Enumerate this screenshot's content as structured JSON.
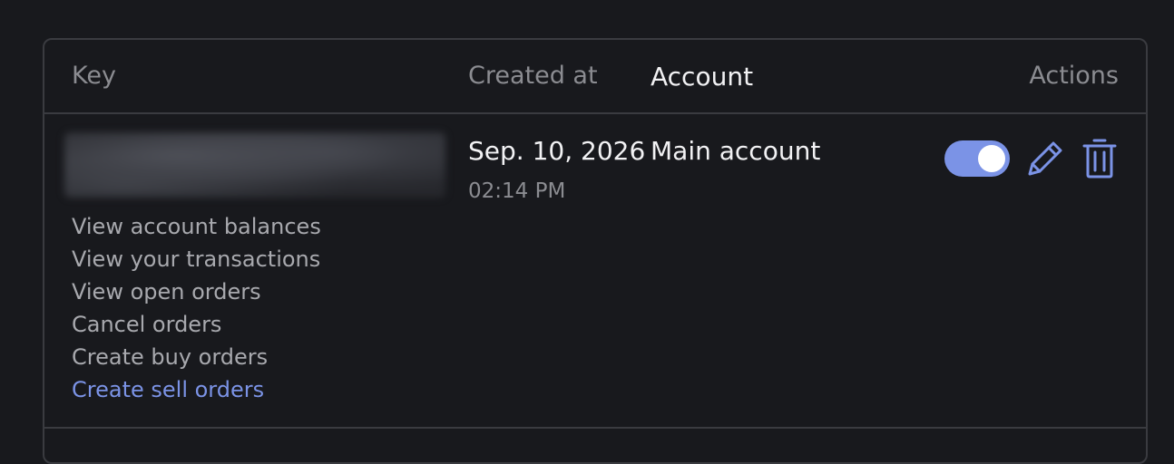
{
  "table": {
    "headers": {
      "key": "Key",
      "created_at": "Created at",
      "account": "Account",
      "actions": "Actions"
    },
    "rows": [
      {
        "permissions": [
          "View account balances",
          "View your transactions",
          "View open orders",
          "Cancel orders",
          "Create buy orders",
          "Create sell orders"
        ],
        "created_date": "Sep. 10, 2026",
        "created_time": "02:14 PM",
        "account": "Main account",
        "enabled": true
      }
    ]
  },
  "colors": {
    "background": "#18191d",
    "accent": "#7b93e6",
    "border": "#3a3b40"
  },
  "icons": {
    "edit": "pencil-icon",
    "delete": "trash-icon"
  }
}
